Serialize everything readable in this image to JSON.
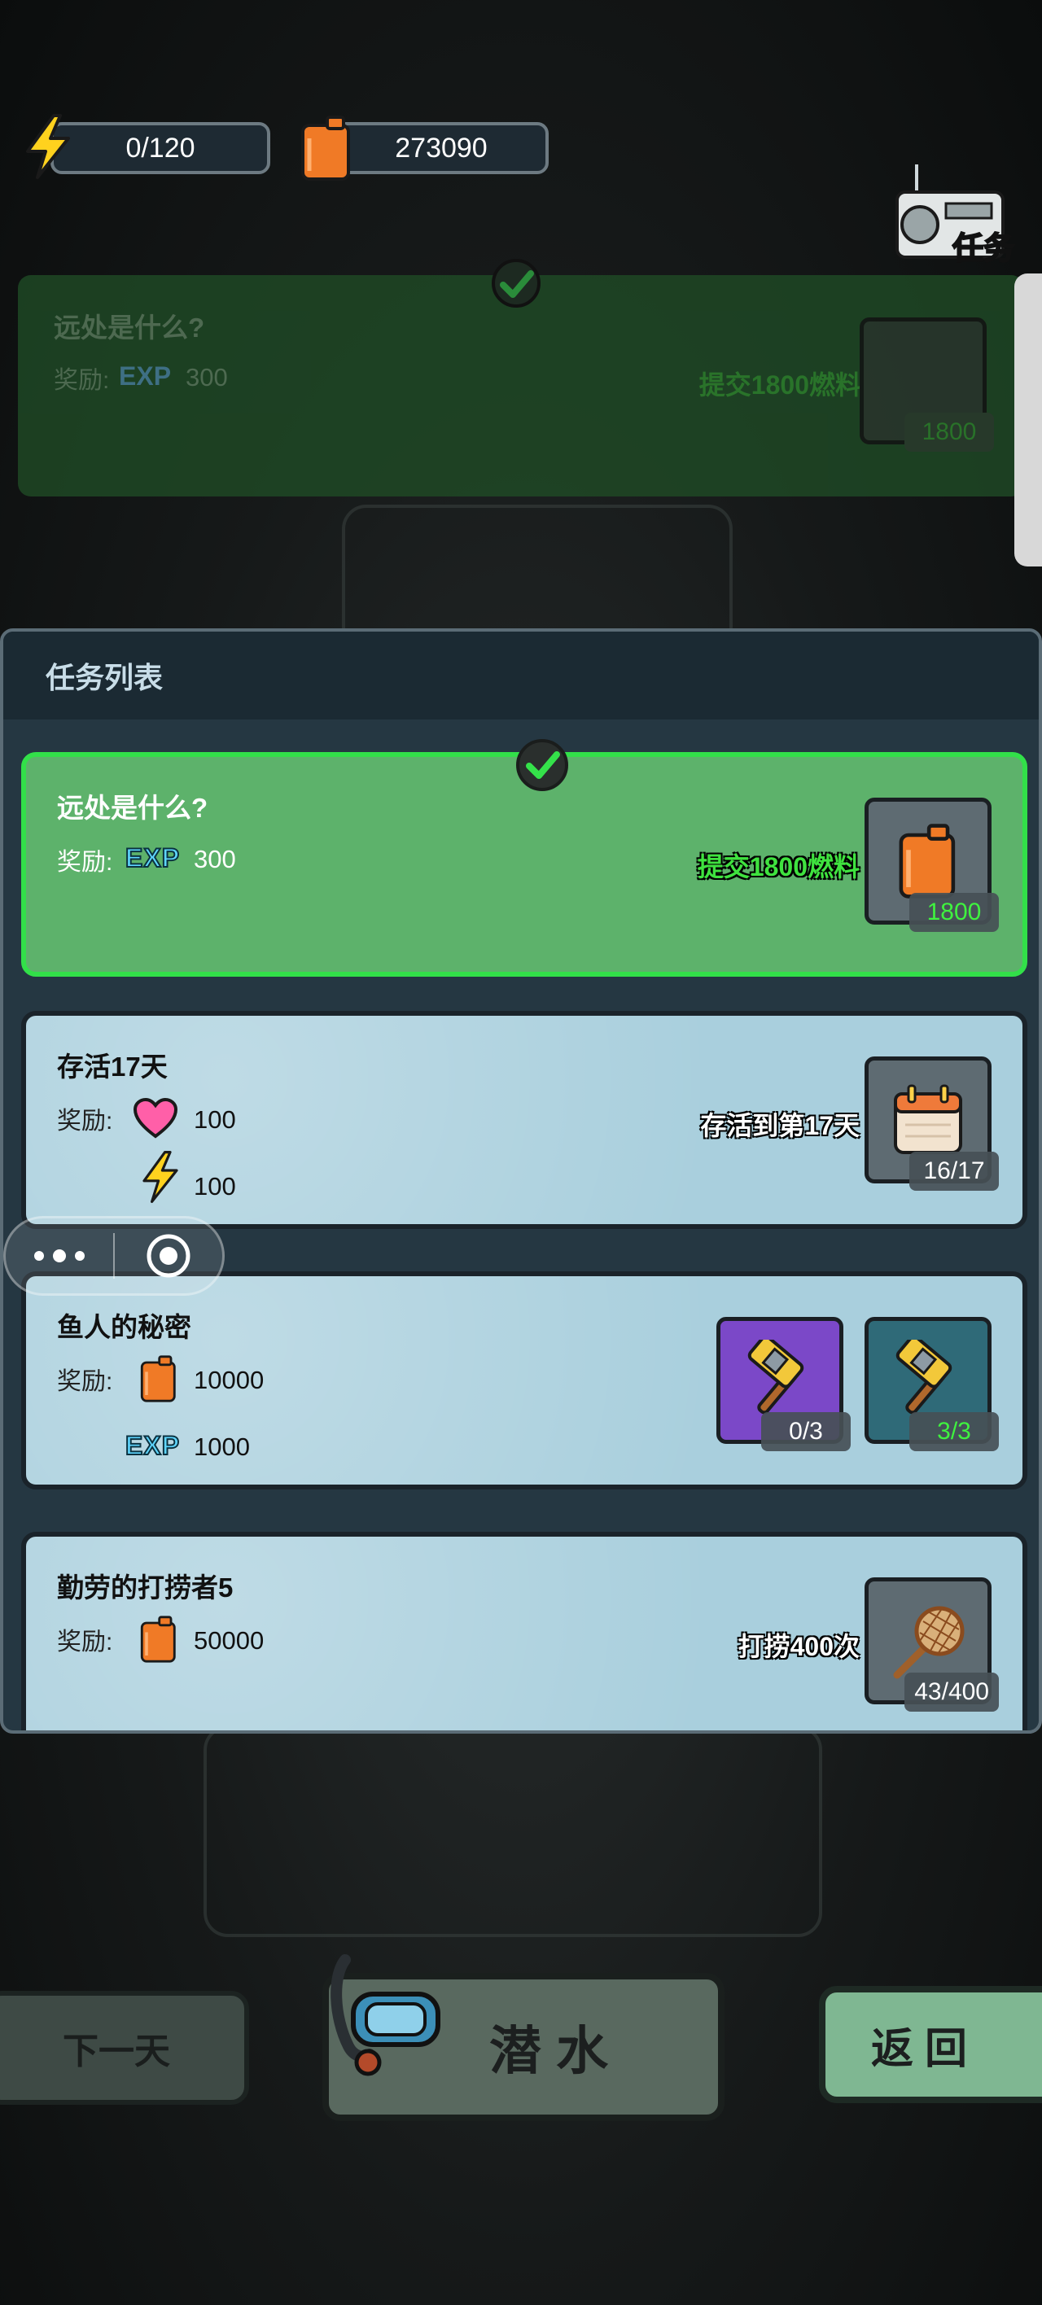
{
  "resources": {
    "energy": "0/120",
    "fuel": "273090"
  },
  "task_button": {
    "label": "任务"
  },
  "dim_card": {
    "title": "远处是什么?",
    "reward_label": "奖励:",
    "exp_label": "EXP",
    "exp_value": "300",
    "requirement": "提交1800燃料",
    "item_count": "1800"
  },
  "modal": {
    "title": "任务列表",
    "tasks": [
      {
        "title": "远处是什么?",
        "reward_label": "奖励:",
        "rewards": [
          {
            "icon": "exp",
            "label": "EXP",
            "value": "300"
          }
        ],
        "requirement": "提交1800燃料",
        "items": [
          {
            "icon": "fuel-can-icon",
            "count": "1800"
          }
        ],
        "completed": true
      },
      {
        "title": "存活17天",
        "reward_label": "奖励:",
        "rewards": [
          {
            "icon": "heart-icon",
            "value": "100"
          },
          {
            "icon": "lightning-icon",
            "value": "100"
          }
        ],
        "requirement": "存活到第17天",
        "items": [
          {
            "icon": "calendar-icon",
            "count": "16/17"
          }
        ],
        "completed": false
      },
      {
        "title": "鱼人的秘密",
        "reward_label": "奖励:",
        "rewards": [
          {
            "icon": "fuel-can-icon",
            "value": "10000"
          },
          {
            "icon": "exp",
            "label": "EXP",
            "value": "1000"
          }
        ],
        "requirement": "",
        "items": [
          {
            "icon": "hammer-icon",
            "count": "0/3"
          },
          {
            "icon": "hammer-icon",
            "count": "3/3"
          }
        ],
        "completed": false
      },
      {
        "title": "勤劳的打捞者5",
        "reward_label": "奖励:",
        "rewards": [
          {
            "icon": "fuel-can-icon",
            "value": "50000"
          }
        ],
        "requirement": "打捞400次",
        "items": [
          {
            "icon": "net-icon",
            "count": "43/400"
          }
        ],
        "completed": false
      }
    ]
  },
  "buttons": {
    "next_day": "下一天",
    "dive": "潜水",
    "back": "返回"
  },
  "colors": {
    "completed_card": "#5db26b",
    "completed_border": "#32e049",
    "progress_green": "#3ff23f",
    "exp_blue": "#5fd6ff"
  }
}
